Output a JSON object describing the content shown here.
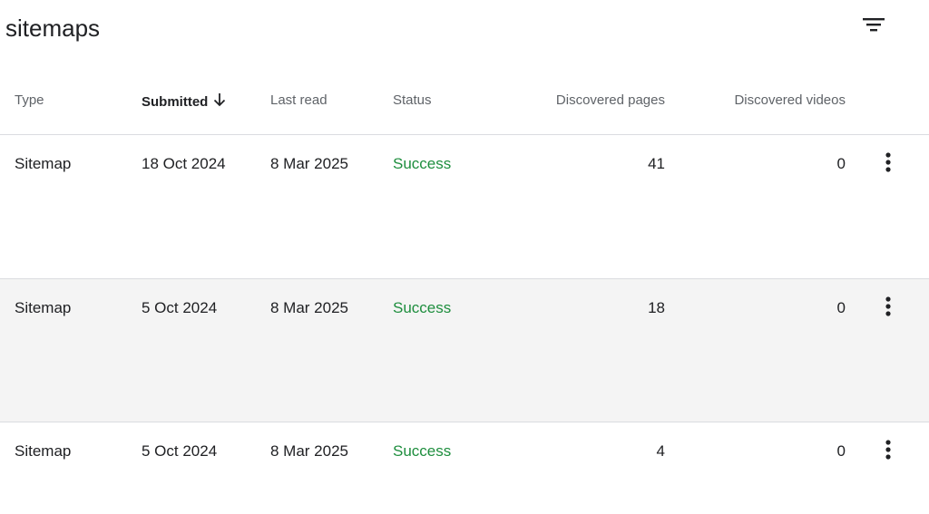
{
  "page": {
    "title": "sitemaps"
  },
  "toolbar": {
    "filter_icon": "filter-icon"
  },
  "table": {
    "columns": {
      "type": "Type",
      "submitted": "Submitted",
      "last_read": "Last read",
      "status": "Status",
      "discovered_pages": "Discovered pages",
      "discovered_videos": "Discovered videos"
    },
    "sort": {
      "column": "submitted",
      "direction": "descending",
      "icon": "arrow-down-icon"
    },
    "rows": [
      {
        "type": "Sitemap",
        "submitted": "18 Oct 2024",
        "last_read": "8 Mar 2025",
        "status": "Success",
        "discovered_pages": "41",
        "discovered_videos": "0"
      },
      {
        "type": "Sitemap",
        "submitted": "5 Oct 2024",
        "last_read": "8 Mar 2025",
        "status": "Success",
        "discovered_pages": "18",
        "discovered_videos": "0"
      },
      {
        "type": "Sitemap",
        "submitted": "5 Oct 2024",
        "last_read": "8 Mar 2025",
        "status": "Success",
        "discovered_pages": "4",
        "discovered_videos": "0"
      }
    ]
  },
  "colors": {
    "success": "#1e8e3e",
    "hover_row": "#f4f4f4",
    "divider": "#dadce0"
  }
}
